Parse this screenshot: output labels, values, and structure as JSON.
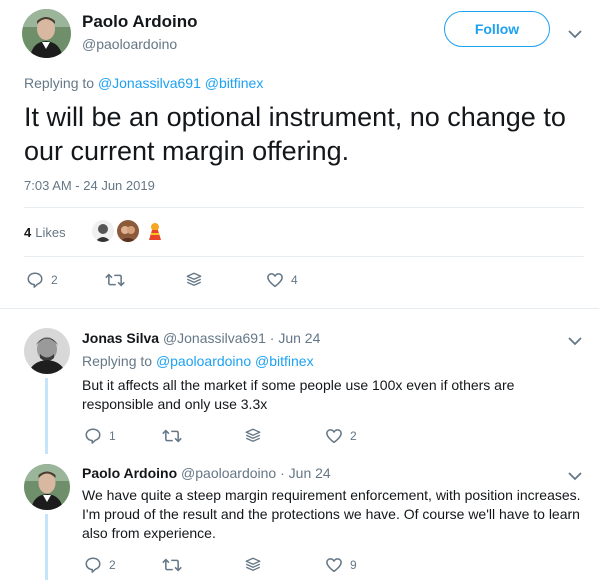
{
  "main_tweet": {
    "author_name": "Paolo Ardoino",
    "author_handle": "@paoloardoino",
    "follow_label": "Follow",
    "replying_prefix": "Replying to",
    "replying_to": [
      "@Jonassilva691",
      "@bitfinex"
    ],
    "text": "It will be an optional instrument, no change to our current margin offering.",
    "timestamp": "7:03 AM - 24 Jun 2019",
    "likes_count": "4",
    "likes_label": "Likes",
    "actions": {
      "reply_count": "2",
      "retweet_count": "",
      "like_count": "4"
    }
  },
  "replies": [
    {
      "author_name": "Jonas Silva",
      "author_handle": "@Jonassilva691 · Jun 24",
      "replying_prefix": "Replying to",
      "replying_to": [
        "@paoloardoino",
        "@bitfinex"
      ],
      "text": "But it affects all the market if some people use 100x even if others are responsible and only use 3.3x",
      "actions": {
        "reply_count": "1",
        "retweet_count": "",
        "like_count": "2"
      }
    },
    {
      "author_name": "Paolo Ardoino",
      "author_handle": "@paoloardoino · Jun 24",
      "text": "We have quite a steep margin requirement enforcement, with position increases. I'm proud of the result and the protections we have. Of course we'll have to learn also from experience.",
      "actions": {
        "reply_count": "2",
        "retweet_count": "",
        "like_count": "9"
      }
    }
  ],
  "icons": {
    "reply": "reply-icon",
    "retweet": "retweet-icon",
    "share": "stack-share-icon",
    "like": "heart-icon",
    "more": "chevron-down-icon"
  },
  "colors": {
    "accent": "#1da1f2",
    "muted": "#657786",
    "text": "#14171a",
    "thread": "#c4e5f9"
  }
}
